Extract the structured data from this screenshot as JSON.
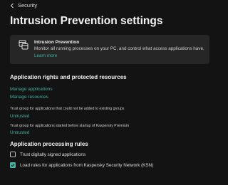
{
  "nav": {
    "back_label": "Security"
  },
  "page": {
    "title": "Intrusion Prevention settings"
  },
  "card": {
    "title": "Intrusion Prevention",
    "description": "Monitor all running processes on your PC, and control what access applications have.",
    "link": "Learn more",
    "icon": "window-app-icon"
  },
  "rights_section": {
    "title": "Application rights and protected resources",
    "manage_applications": "Manage applications",
    "manage_resources": "Manage resources",
    "trust_group_label": "Trust group for applications that could not be added to existing groups",
    "trust_group_value": "Untrusted",
    "startup_group_label": "Trust group for applications started before startup of Kaspersky Premium",
    "startup_group_value": "Untrusted"
  },
  "processing_section": {
    "title": "Application processing rules",
    "option_signed": {
      "label": "Trust digitally signed applications",
      "checked": false
    },
    "option_ksn": {
      "label": "Load rules for applications from Kaspersky Security Network (KSN)",
      "checked": true
    }
  },
  "colors": {
    "accent": "#3fb39e",
    "background": "#131313",
    "card": "#262626"
  }
}
